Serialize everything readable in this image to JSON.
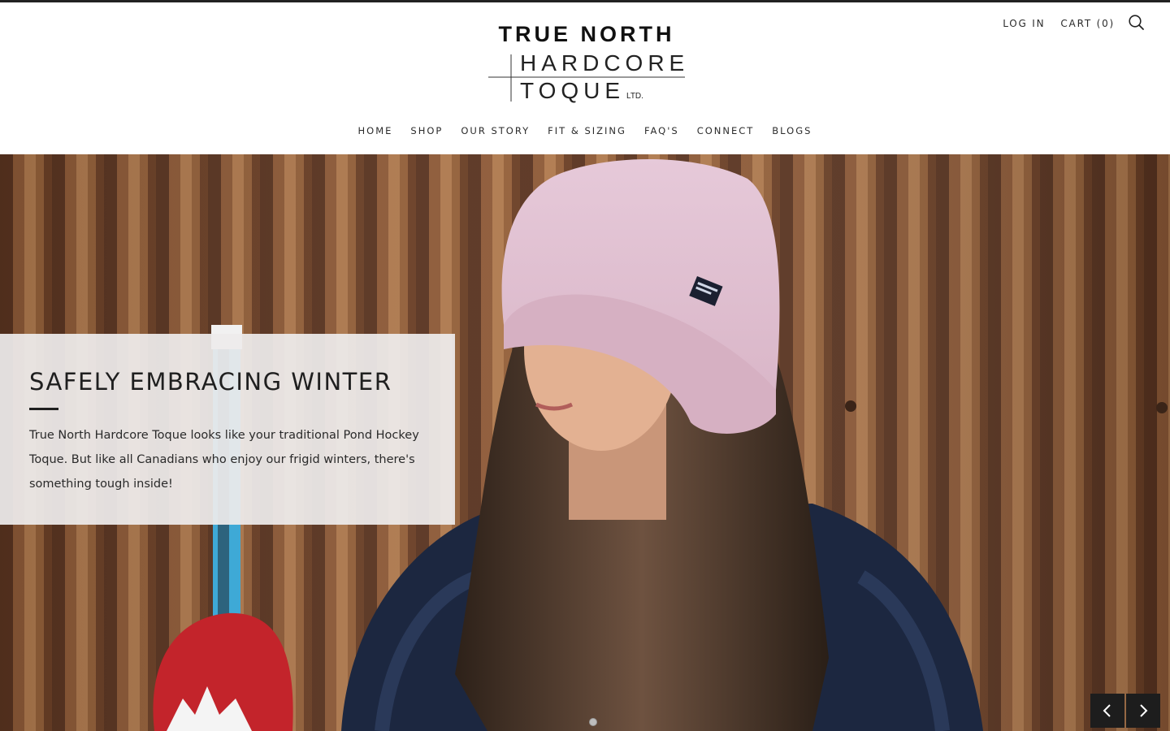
{
  "brand": {
    "line1": "TRUE NORTH",
    "line2": "HARDCORE",
    "line3": "TOQUE",
    "suffix": "LTD."
  },
  "header": {
    "login_label": "LOG IN",
    "cart_label": "CART",
    "cart_count": "0",
    "search_icon": "search-icon"
  },
  "nav": {
    "items": [
      {
        "label": "HOME"
      },
      {
        "label": "SHOP"
      },
      {
        "label": "OUR STORY"
      },
      {
        "label": "FIT & SIZING"
      },
      {
        "label": "FAQ'S"
      },
      {
        "label": "CONNECT"
      },
      {
        "label": "BLOGS"
      }
    ]
  },
  "hero": {
    "title": "SAFELY EMBRACING WINTER",
    "text": "True North Hardcore Toque looks like your traditional Pond Hockey Toque. But like all Canadians who enjoy our frigid winters, there's something tough inside!",
    "slides_total": 1,
    "active_slide": 1,
    "prev_icon": "chevron-left-icon",
    "next_icon": "chevron-right-icon"
  },
  "colors": {
    "accent": "#1f1f1f",
    "card_bg": "#eeecec",
    "toque_pink": "#e3c6d6",
    "wall_rust": "#7a4a2c"
  }
}
